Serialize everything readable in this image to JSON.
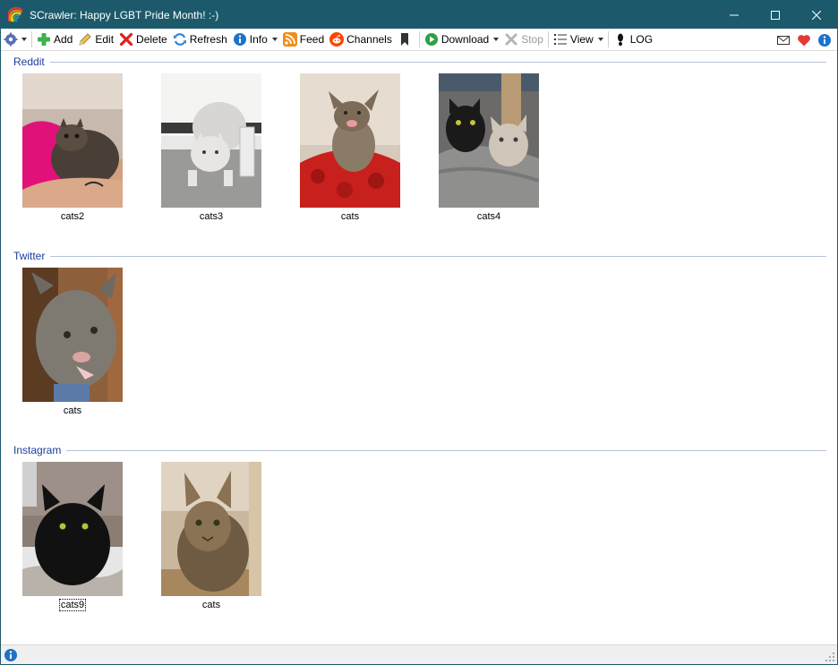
{
  "window": {
    "title": "SCrawler: Happy LGBT Pride Month! :-)"
  },
  "toolbar": {
    "add": "Add",
    "edit": "Edit",
    "delete": "Delete",
    "refresh": "Refresh",
    "info": "Info",
    "feed": "Feed",
    "channels": "Channels",
    "download": "Download",
    "stop": "Stop",
    "view": "View",
    "log": "LOG"
  },
  "groups": [
    {
      "title": "Reddit",
      "items": [
        {
          "label": "cats2"
        },
        {
          "label": "cats3"
        },
        {
          "label": "cats"
        },
        {
          "label": "cats4"
        }
      ]
    },
    {
      "title": "Twitter",
      "items": [
        {
          "label": "cats"
        }
      ]
    },
    {
      "title": "Instagram",
      "items": [
        {
          "label": "cats9"
        },
        {
          "label": "cats"
        }
      ]
    }
  ],
  "colors": {
    "titlebar": "#1c5a6b",
    "group_title": "#1e3d9c",
    "accent_blue": "#1e73c9",
    "heart": "#e53935"
  },
  "icons": {
    "app": "rainbow-icon",
    "settings": "gear-icon",
    "add": "plus-icon",
    "edit": "pencil-icon",
    "delete": "x-icon",
    "refresh": "refresh-icon",
    "info": "info-icon",
    "feed": "rss-icon",
    "channels": "reddit-icon",
    "bookmark": "bookmark-icon",
    "download": "play-icon",
    "stop": "stop-icon",
    "view": "list-icon",
    "log": "footprint-icon",
    "mail": "mail-icon",
    "heart": "heart-icon",
    "about": "info-icon"
  }
}
